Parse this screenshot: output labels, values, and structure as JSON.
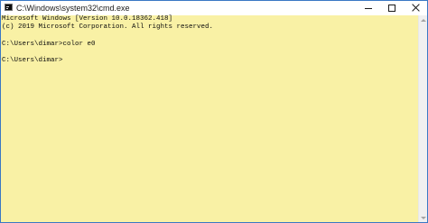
{
  "window": {
    "title": "C:\\Windows\\system32\\cmd.exe",
    "icon": "cmd-icon"
  },
  "caption_buttons": {
    "minimize_icon": "minimize-icon",
    "maximize_icon": "maximize-icon",
    "close_icon": "close-icon"
  },
  "console": {
    "background_color": "#f9f1a5",
    "text_color": "#0c0c0c",
    "lines": [
      "Microsoft Windows [Version 10.0.18362.418]",
      "(c) 2019 Microsoft Corporation. All rights reserved.",
      "",
      "C:\\Users\\dimar>color e0",
      "",
      "C:\\Users\\dimar>"
    ]
  },
  "scrollbar": {
    "up_icon": "scroll-up-arrow-icon",
    "down_icon": "scroll-down-arrow-icon"
  }
}
